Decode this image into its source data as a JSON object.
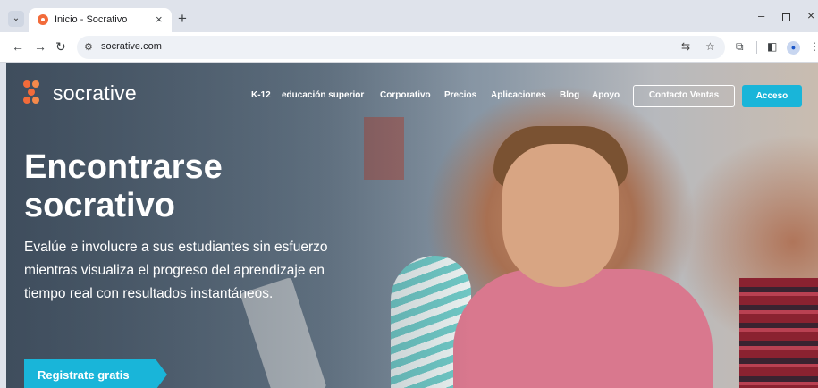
{
  "browser": {
    "tab_title": "Inicio - Socrativo",
    "tab_close": "×",
    "new_tab": "+",
    "menu_icon": "⌄",
    "url": "socrative.com",
    "window_minimize": "–",
    "window_close": "×"
  },
  "site": {
    "logo_text": "socrative",
    "brand_orange": "#f26b3a",
    "accent_cyan": "#19b5d9",
    "nav": [
      "K-12",
      "educación superior",
      "Corporativo",
      "Precios",
      "Aplicaciones",
      "Blog",
      "Apoyo"
    ],
    "contact_button": "Contacto Ventas",
    "access_button": "Acceso"
  },
  "hero": {
    "title": "Encontrarse socrativo",
    "description": "Evalúe e involucre a sus estudiantes sin esfuerzo mientras visualiza el progreso del aprendizaje en tiempo real con resultados instantáneos.",
    "cta": "Registrate gratis"
  }
}
